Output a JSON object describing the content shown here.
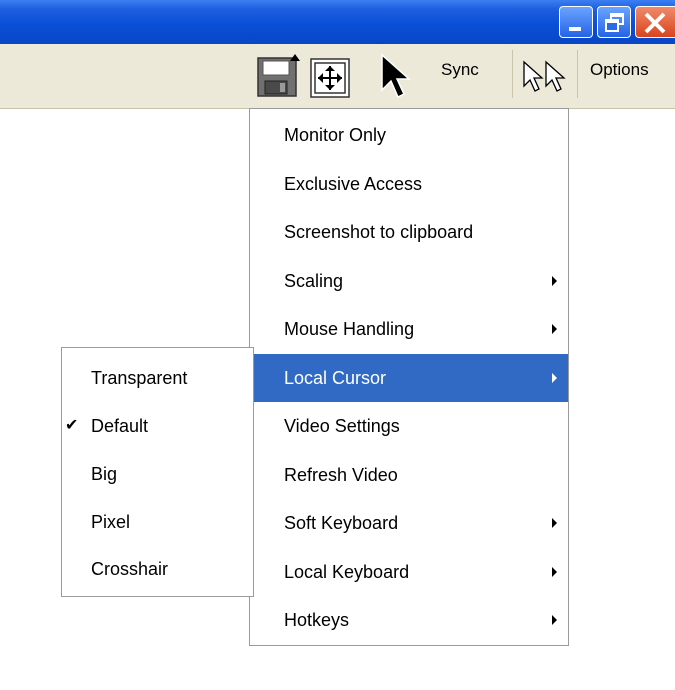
{
  "window_controls": {
    "icons": [
      "minimize-icon",
      "restore-icon",
      "close-icon"
    ],
    "close_color": "#d9441c"
  },
  "toolbar": {
    "sync_label": "Sync",
    "options_label": "Options",
    "icons": [
      "save-screenshot-icon",
      "fit-window-icon",
      "pointer-cursor-icon",
      "dual-cursor-icon"
    ]
  },
  "main_menu": {
    "items": [
      {
        "label": "Monitor Only",
        "submenu": false
      },
      {
        "label": "Exclusive Access",
        "submenu": false
      },
      {
        "label": "Screenshot to clipboard",
        "submenu": false
      },
      {
        "label": "Scaling",
        "submenu": true
      },
      {
        "label": "Mouse Handling",
        "submenu": true
      },
      {
        "label": "Local Cursor",
        "submenu": true,
        "highlighted": true
      },
      {
        "label": "Video Settings",
        "submenu": false
      },
      {
        "label": "Refresh Video",
        "submenu": false
      },
      {
        "label": "Soft Keyboard",
        "submenu": true
      },
      {
        "label": "Local Keyboard",
        "submenu": true
      },
      {
        "label": "Hotkeys",
        "submenu": true
      }
    ],
    "highlight_color": "#316ac5"
  },
  "cursor_submenu": {
    "items": [
      {
        "label": "Transparent",
        "checked": false
      },
      {
        "label": "Default",
        "checked": true
      },
      {
        "label": "Big",
        "checked": false
      },
      {
        "label": "Pixel",
        "checked": false
      },
      {
        "label": "Crosshair",
        "checked": false
      }
    ]
  }
}
